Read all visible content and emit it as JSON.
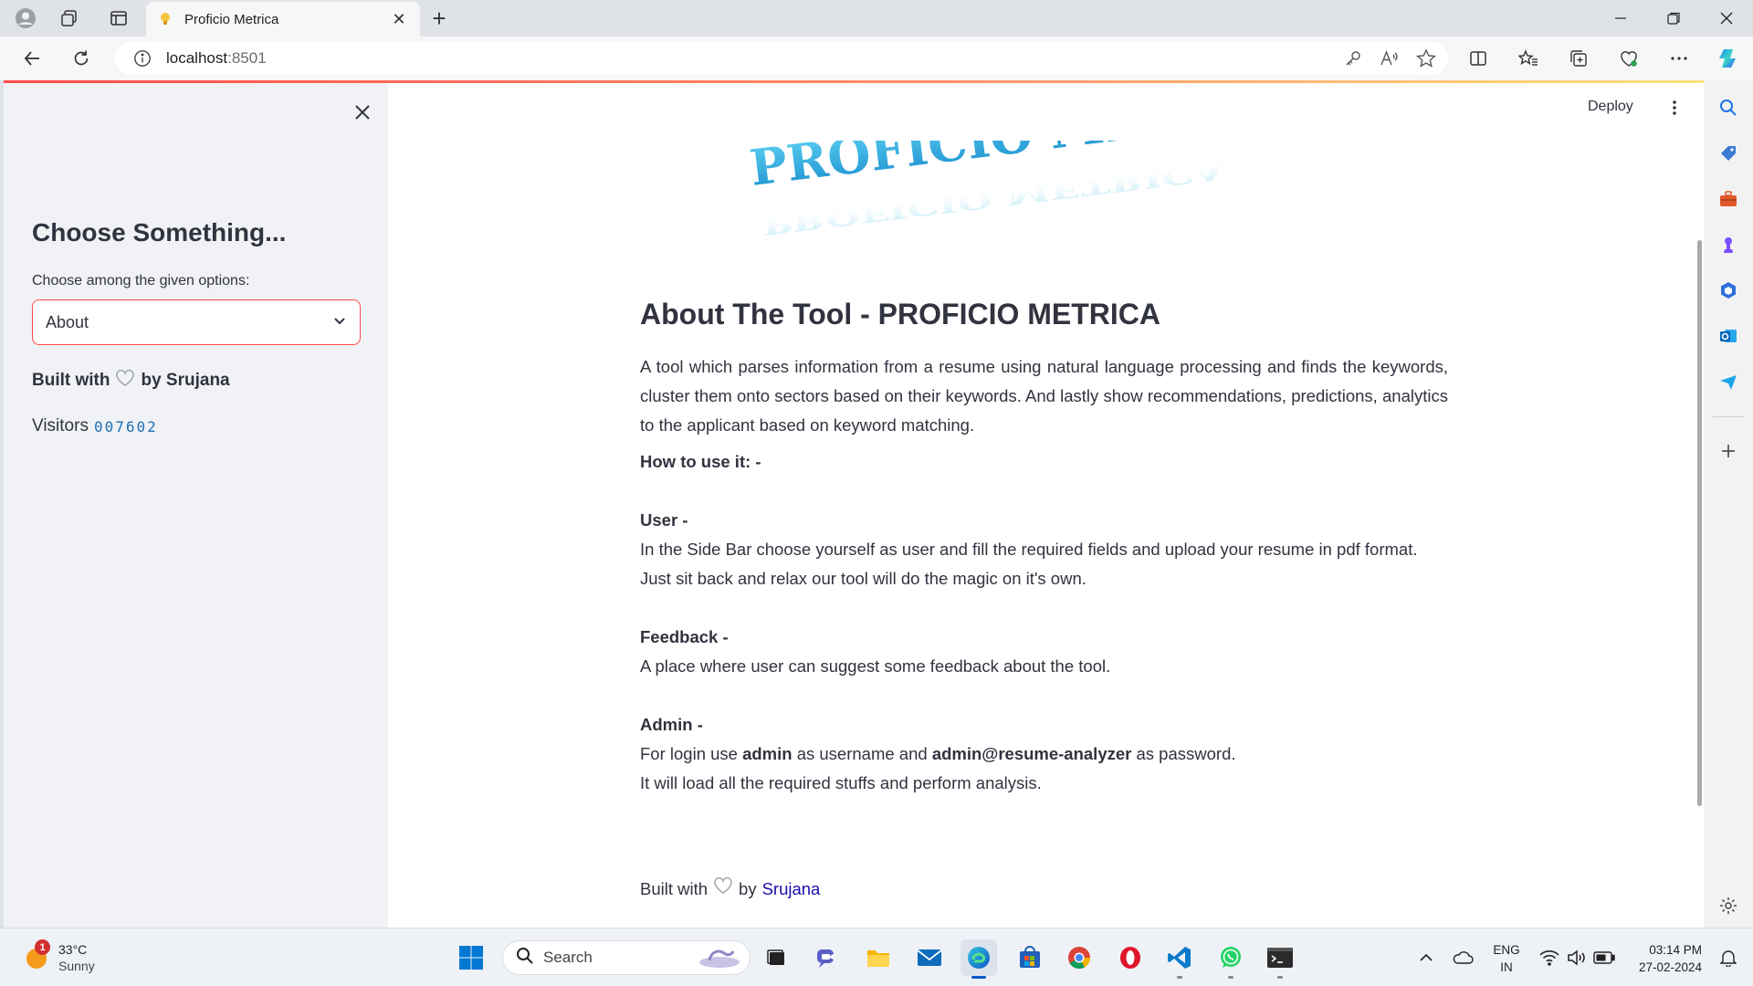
{
  "browser": {
    "tab_title": "Proficio Metrica",
    "url_host": "localhost",
    "url_port": ":8501"
  },
  "app": {
    "deploy_label": "Deploy",
    "banner_text": "PROFICIO METRICA",
    "sidebar": {
      "heading": "Choose Something...",
      "select_label": "Choose among the given options:",
      "select_value": "About",
      "built_prefix": "Built with",
      "built_suffix": "by Srujana",
      "visitors_label": "Visitors",
      "visitors_count": "007602"
    },
    "main": {
      "title": "About The Tool - PROFICIO METRICA",
      "intro": "A tool which parses information from a resume using natural language processing and finds the keywords, cluster them onto sectors based on their keywords. And lastly show recommendations, predictions, analytics to the applicant based on keyword matching.",
      "how_to": "How to use it: -",
      "user_heading": "User -",
      "user_line1": "In the Side Bar choose yourself as user and fill the required fields and upload your resume in pdf format.",
      "user_line2": "Just sit back and relax our tool will do the magic on it's own.",
      "feedback_heading": "Feedback -",
      "feedback_line": "A place where user can suggest some feedback about the tool.",
      "admin_heading": "Admin -",
      "admin_pre": "For login use",
      "admin_user": "admin",
      "admin_mid": "as username and",
      "admin_pass": "admin@resume-analyzer",
      "admin_post": "as password.",
      "admin_line2": "It will load all the required stuffs and perform analysis.",
      "footer_prefix": "Built with",
      "footer_by": "by",
      "footer_link": "Srujana"
    }
  },
  "taskbar": {
    "weather_temp": "33°C",
    "weather_desc": "Sunny",
    "weather_badge": "1",
    "search_placeholder": "Search",
    "lang_line1": "ENG",
    "lang_line2": "IN",
    "time": "03:14 PM",
    "date": "27-02-2024"
  },
  "colors": {
    "accent": "#ff4b4b",
    "sidebar_bg": "#f0f2f6",
    "text": "#31333f",
    "link": "#1a0dab"
  }
}
